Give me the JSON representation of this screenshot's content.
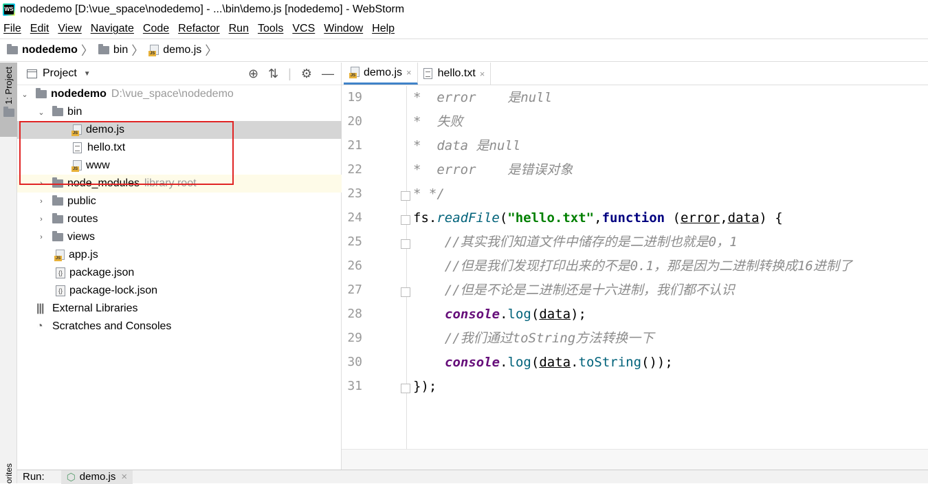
{
  "window": {
    "title": "nodedemo [D:\\vue_space\\nodedemo] - ...\\bin\\demo.js [nodedemo] - WebStorm",
    "logo": "WS"
  },
  "menu": [
    "File",
    "Edit",
    "View",
    "Navigate",
    "Code",
    "Refactor",
    "Run",
    "Tools",
    "VCS",
    "Window",
    "Help"
  ],
  "breadcrumb": [
    "nodedemo",
    "bin",
    "demo.js"
  ],
  "sidebar": {
    "project_tab": "1: Project",
    "favorites_tab": "orites"
  },
  "project": {
    "header": "Project",
    "tree": [
      {
        "label": "nodedemo",
        "hint": "D:\\vue_space\\nodedemo",
        "type": "folder",
        "arrow": "⌄"
      },
      {
        "label": "bin",
        "type": "folder",
        "arrow": "⌄"
      },
      {
        "label": "demo.js",
        "type": "js"
      },
      {
        "label": "hello.txt",
        "type": "txt"
      },
      {
        "label": "www",
        "type": "js"
      },
      {
        "label": "node_modules",
        "hint": "library root",
        "type": "folder",
        "arrow": "›"
      },
      {
        "label": "public",
        "type": "folder",
        "arrow": "›"
      },
      {
        "label": "routes",
        "type": "folder",
        "arrow": "›"
      },
      {
        "label": "views",
        "type": "folder",
        "arrow": "›"
      },
      {
        "label": "app.js",
        "type": "js"
      },
      {
        "label": "package.json",
        "type": "json"
      },
      {
        "label": "package-lock.json",
        "type": "json"
      },
      {
        "label": "External Libraries",
        "type": "lib"
      },
      {
        "label": "Scratches and Consoles",
        "type": "scratch"
      }
    ]
  },
  "editor": {
    "tabs": [
      {
        "label": "demo.js",
        "close": "×"
      },
      {
        "label": "hello.txt",
        "close": "×"
      }
    ],
    "line_numbers": [
      "19",
      "20",
      "21",
      "22",
      "23",
      "24",
      "25",
      "26",
      "27",
      "28",
      "29",
      "30",
      "31"
    ],
    "lines": {
      "l19": "*  error    是null",
      "l20": "*  失败",
      "l21": "*  data 是null",
      "l22": "*  error    是错误对象",
      "l23": "* */",
      "l24_fs": "fs.",
      "l24_fn": "readFile",
      "l24_p1": "(",
      "l24_str": "\"hello.txt\"",
      "l24_comma": ",",
      "l24_kw": "function",
      "l24_sp": " (",
      "l24_err": "error",
      "l24_c2": ",",
      "l24_data": "data",
      "l24_end": ") {",
      "l25": "    //其实我们知道文件中储存的是二进制也就是0，1",
      "l26": "    //但是我们发现打印出来的不是0.1，那是因为二进制转换成16进制了",
      "l27": "    //但是不论是二进制还是十六进制，我们都不认识",
      "l28_obj": "console",
      "l28_dot": ".",
      "l28_m": "log",
      "l28_p": "(",
      "l28_data": "data",
      "l28_end": ");",
      "l29": "    //我们通过toString方法转换一下",
      "l30_obj": "console",
      "l30_dot": ".",
      "l30_m": "log",
      "l30_p": "(",
      "l30_data": "data",
      "l30_dot2": ".",
      "l30_m2": "toString",
      "l30_end": "());",
      "l31": "});"
    }
  },
  "run": {
    "label": "Run:",
    "tab": "demo.js",
    "close": "×"
  }
}
